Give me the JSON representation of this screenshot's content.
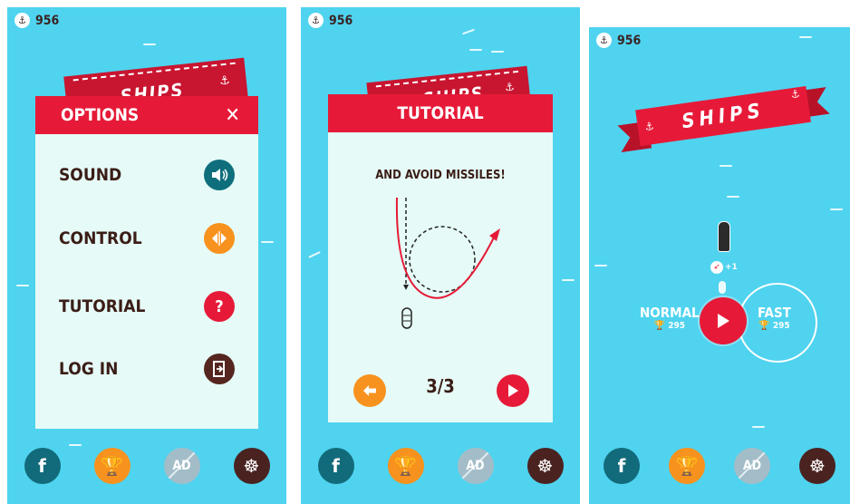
{
  "coins": "956",
  "options_screen": {
    "title": "OPTIONS",
    "close_label": "✕",
    "rows": [
      {
        "label": "SOUND",
        "color": "#0e6e7c"
      },
      {
        "label": "CONTROL",
        "color": "#f7921e"
      },
      {
        "label": "TUTORIAL",
        "color": "#e61a38"
      },
      {
        "label": "LOG IN",
        "color": "#55261f"
      }
    ],
    "banner_peek": "SHIPS"
  },
  "tutorial_screen": {
    "title": "TUTORIAL",
    "instruction": "AND AVOID MISSILES!",
    "page_indicator": "3/3"
  },
  "home_screen": {
    "logo_text": "SHIPS",
    "bonus": "+1",
    "modes": [
      {
        "label": "NORMAL",
        "score": "295"
      },
      {
        "label": "FAST",
        "score": "295"
      }
    ]
  },
  "bottom_bar": {
    "ad_label": "AD"
  },
  "colors": {
    "sea": "#4fd3ef",
    "red": "#e61a38",
    "panel": "#e6fbf7",
    "orange": "#f7921e",
    "teal": "#0e6e7c",
    "brown": "#4a2321"
  }
}
